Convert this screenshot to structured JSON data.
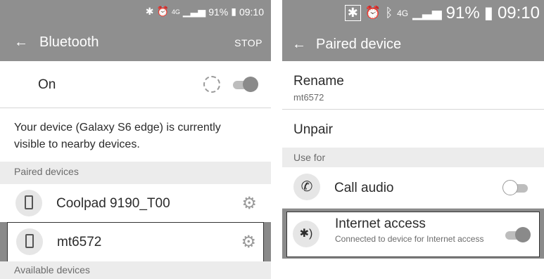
{
  "left": {
    "status": {
      "bluetooth_icon": "bluetooth-icon",
      "alarm_icon": "alarm-icon",
      "network": "4G",
      "battery": "91%",
      "time": "09:10"
    },
    "appbar": {
      "back_icon": "back-arrow-icon",
      "title": "Bluetooth",
      "action": "STOP"
    },
    "toggle_row": {
      "label": "On",
      "toggle_on": true
    },
    "visibility_text": "Your device (Galaxy S6 edge) is currently visible to nearby devices.",
    "paired_header": "Paired devices",
    "paired": [
      {
        "name": "Coolpad 9190_T00"
      },
      {
        "name": "mt6572"
      }
    ],
    "available_header": "Available devices"
  },
  "right": {
    "status": {
      "bluetooth_icon": "bluetooth-icon",
      "alarm_icon": "alarm-icon",
      "app_icon": "bluetooth-app-icon",
      "network": "4G",
      "battery": "91%",
      "time": "09:10"
    },
    "appbar": {
      "back_icon": "back-arrow-icon",
      "title": "Paired device"
    },
    "rename": {
      "label": "Rename",
      "value": "mt6572"
    },
    "unpair": "Unpair",
    "use_for_header": "Use for",
    "call_audio": {
      "label": "Call audio",
      "toggle_on": false
    },
    "internet": {
      "label": "Internet access",
      "subtitle": "Connected to device for Internet access",
      "toggle_on": true
    }
  }
}
